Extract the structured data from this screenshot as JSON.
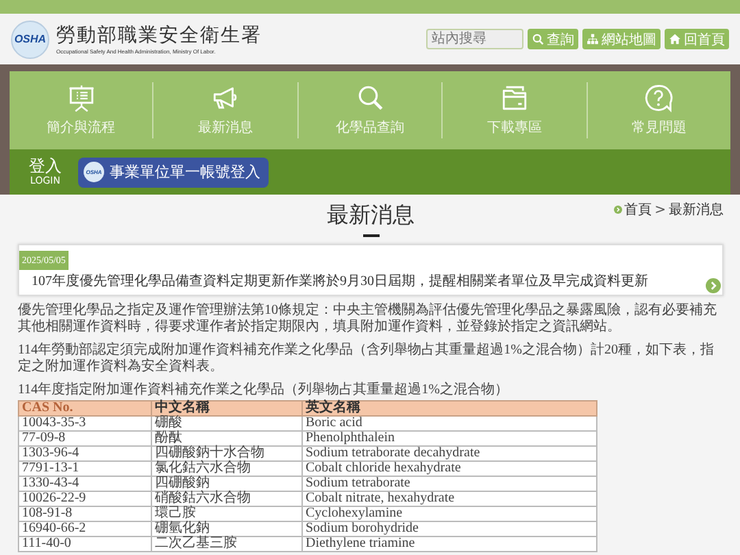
{
  "header": {
    "logo_text": "OSHA",
    "title": "勞動部職業安全衛生署",
    "subtitle": "Occupational Safety And Health Administration, Ministry Of Labor.",
    "search": {
      "placeholder": "站內搜尋"
    },
    "buttons": [
      {
        "label": "查詢"
      },
      {
        "label": "網站地圖"
      },
      {
        "label": "回首頁"
      }
    ]
  },
  "nav": {
    "items": [
      {
        "label": "簡介與流程"
      },
      {
        "label": "最新消息"
      },
      {
        "label": "化學品查詢"
      },
      {
        "label": "下載專區"
      },
      {
        "label": "常見問題"
      }
    ]
  },
  "login": {
    "title": "登入",
    "subtitle": "LOGIN",
    "button": {
      "logo_text": "OSHA",
      "label": "事業單位單一帳號登入"
    }
  },
  "breadcrumb": {
    "items": [
      "首頁",
      "最新消息"
    ],
    "separator": ">"
  },
  "page_title": "最新消息",
  "news": [
    {
      "date": "2025/05/05",
      "title": "107年度優先管理化學品備查資料定期更新作業將於9月30日屆期，提醒相關業者單位及早完成資料更新"
    }
  ],
  "paragraphs": [
    "優先管理化學品之指定及運作管理辦法第10條規定：中央主管機關為評估優先管理化學品之暴露風險，認有必要補充其他相關運作資料時，得要求運作者於指定期限內，填具附加運作資料，並登錄於指定之資訊網站。",
    "114年勞動部認定須完成附加運作資料補充作業之化學品（含列舉物占其重量超過1%之混合物）計20種，如下表，指定之附加運作資料為安全資料表。"
  ],
  "table": {
    "caption": "114年度指定附加運作資料補充作業之化學品（列舉物占其重量超過1%之混合物）",
    "columns": [
      "CAS No.",
      "中文名稱",
      "英文名稱"
    ],
    "rows": [
      [
        "10043-35-3",
        "硼酸",
        "Boric acid"
      ],
      [
        "77-09-8",
        "酚酞",
        "Phenolphthalein"
      ],
      [
        "1303-96-4",
        "四硼酸鈉十水合物",
        "Sodium tetraborate decahydrate"
      ],
      [
        "7791-13-1",
        "氯化鈷六水合物",
        "Cobalt chloride hexahydrate"
      ],
      [
        "1330-43-4",
        "四硼酸鈉",
        "Sodium tetraborate"
      ],
      [
        "10026-22-9",
        "硝酸鈷六水合物",
        "Cobalt nitrate, hexahydrate"
      ],
      [
        "108-91-8",
        "環己胺",
        "Cyclohexylamine"
      ],
      [
        "16940-66-2",
        "硼氫化鈉",
        "Sodium borohydride"
      ],
      [
        "111-40-0",
        "二次乙基三胺",
        "Diethylene triamine"
      ]
    ]
  }
}
